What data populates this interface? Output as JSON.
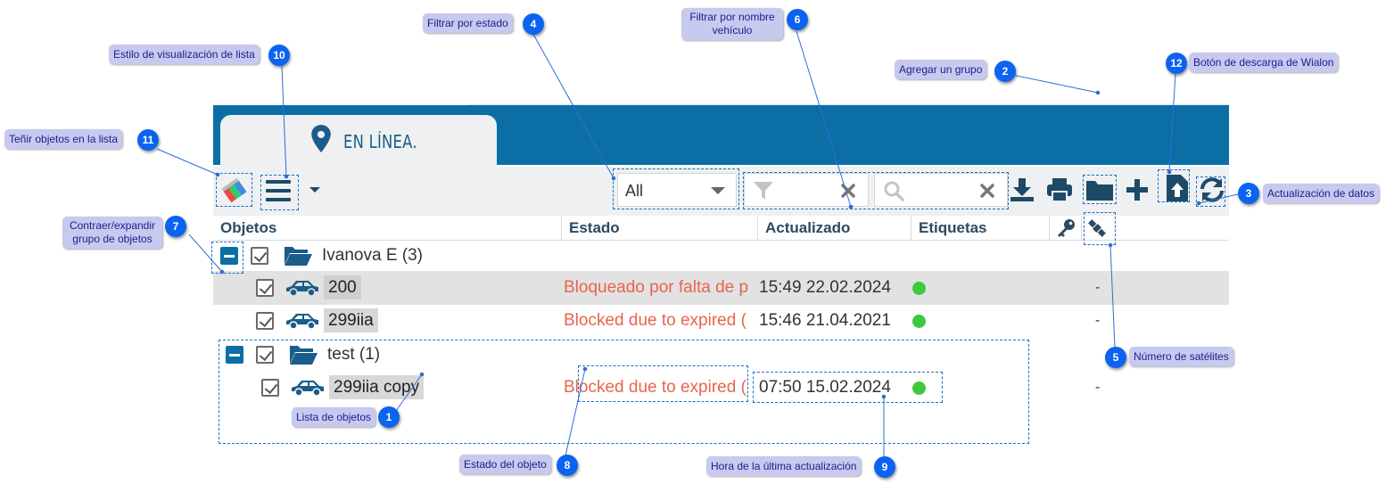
{
  "tab": {
    "label": "EN LÍNEA."
  },
  "filter": {
    "selected": "All"
  },
  "columns": [
    "Objetos",
    "Estado",
    "Actualizado",
    "Etiquetas"
  ],
  "groups": [
    {
      "name": "Ivanova E (3)"
    },
    {
      "name": "test (1)"
    }
  ],
  "objects": [
    {
      "name": "200",
      "status": "Bloqueado por falta de p",
      "updated": "15:49 22.02.2024",
      "sats": "-"
    },
    {
      "name": "299iia",
      "status": "Blocked due to expired (",
      "updated": "15:46 21.04.2021",
      "sats": "-"
    },
    {
      "name": "299iia copy",
      "status": "Blocked due to expired (",
      "updated": "07:50 15.02.2024",
      "sats": "-"
    }
  ],
  "colors": {
    "brand": "#0b6fa6",
    "status": "#e8654f",
    "online": "#3dc93d",
    "badge": "#0b63f0",
    "callout": "#c7c9ef"
  },
  "icons": [
    "map-pin-icon",
    "color-tag-icon",
    "list-style-icon",
    "chevron-down-icon",
    "filter-icon",
    "clear-icon",
    "search-icon",
    "download-icon",
    "print-icon",
    "folder-icon",
    "plus-icon",
    "upload-file-icon",
    "refresh-icon",
    "key-icon",
    "satellite-icon",
    "car-icon",
    "folder-open-icon"
  ],
  "annotations": {
    "a1": {
      "num": "1",
      "label": "Lista de objetos"
    },
    "a2": {
      "num": "2",
      "label": "Agregar un grupo"
    },
    "a3": {
      "num": "3",
      "label": "Actualización de datos"
    },
    "a4": {
      "num": "4",
      "label": "Filtrar por estado"
    },
    "a5": {
      "num": "5",
      "label": "Número de satélites"
    },
    "a6": {
      "num": "6",
      "label1": "Filtrar por nombre",
      "label2": "vehículo"
    },
    "a7": {
      "num": "7",
      "label1": "Contraer/expandir",
      "label2": "grupo de objetos"
    },
    "a8": {
      "num": "8",
      "label": "Estado del objeto"
    },
    "a9": {
      "num": "9",
      "label": "Hora de la última actualización"
    },
    "a10": {
      "num": "10",
      "label": "Estilo de visualización de lista"
    },
    "a11": {
      "num": "11",
      "label": "Teñir objetos en la lista"
    },
    "a12": {
      "num": "12",
      "label": "Botón de descarga de Wialon"
    }
  }
}
